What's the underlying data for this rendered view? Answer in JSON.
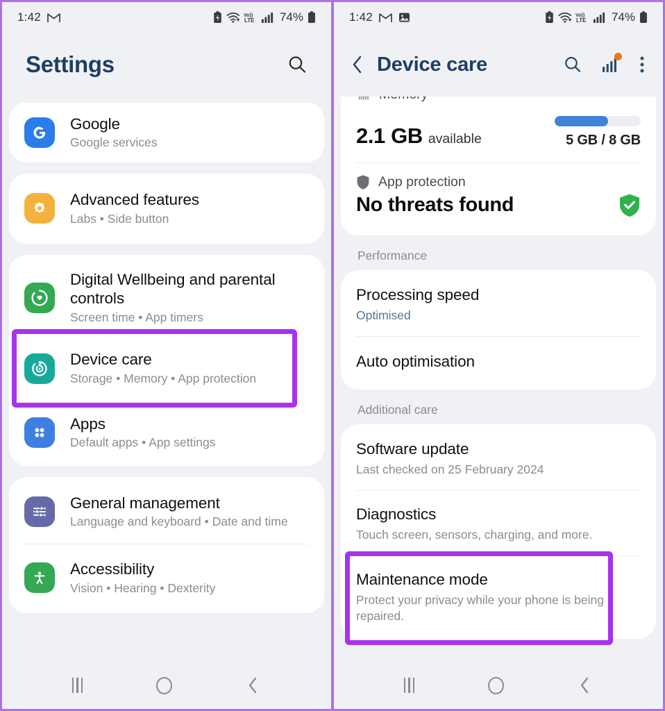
{
  "status_bar": {
    "time": "1:42",
    "battery_percent": "74%",
    "icons_left": [
      "gmail-icon",
      "gallery-icon"
    ],
    "icons_right": [
      "battery-saver-icon",
      "wifi-icon",
      "volte-icon",
      "signal-bars-icon",
      "battery-icon"
    ]
  },
  "left_phone": {
    "header": {
      "title": "Settings",
      "search_icon": "search-icon"
    },
    "groups": [
      {
        "items": [
          {
            "title": "Google",
            "subtitle": "Google services",
            "icon": "google-icon"
          }
        ]
      },
      {
        "items": [
          {
            "title": "Advanced features",
            "subtitle": "Labs  •  Side button",
            "icon": "gear-icon"
          }
        ]
      },
      {
        "items": [
          {
            "title": "Digital Wellbeing and parental controls",
            "subtitle": "Screen time  •  App timers",
            "icon": "wellbeing-icon"
          },
          {
            "title": "Device care",
            "subtitle": "Storage  •  Memory  •  App protection",
            "icon": "device-care-icon",
            "highlighted": true
          },
          {
            "title": "Apps",
            "subtitle": "Default apps  •  App settings",
            "icon": "apps-grid-icon"
          }
        ]
      },
      {
        "items": [
          {
            "title": "General management",
            "subtitle": "Language and keyboard  •  Date and time",
            "icon": "sliders-icon"
          },
          {
            "title": "Accessibility",
            "subtitle": "Vision  •  Hearing  •  Dexterity",
            "icon": "accessibility-icon"
          }
        ]
      }
    ]
  },
  "right_phone": {
    "header": {
      "title": "Device care",
      "back_icon": "chevron-left-icon",
      "search_icon": "search-icon",
      "stats_icon": "bar-chart-icon",
      "overflow_icon": "more-vertical-icon",
      "badge_color": "#f0761e"
    },
    "memory": {
      "label": "Memory",
      "icon": "memory-chip-icon",
      "value": "2.1 GB",
      "unit": "available",
      "usage_text": "5 GB / 8 GB",
      "progress_percent": 62,
      "progress_color": "#3f83d4"
    },
    "app_protection": {
      "label": "App protection",
      "icon": "shield-icon",
      "status": "No threats found",
      "status_icon": "shield-check-icon",
      "status_color": "#2fb14c"
    },
    "sections": [
      {
        "label": "Performance",
        "items": [
          {
            "title": "Processing speed",
            "subtitle": "Optimised",
            "subtitle_style": "blue"
          },
          {
            "title": "Auto optimisation",
            "subtitle": ""
          }
        ]
      },
      {
        "label": "Additional care",
        "items": [
          {
            "title": "Software update",
            "subtitle": "Last checked on 25 February 2024"
          },
          {
            "title": "Diagnostics",
            "subtitle": "Touch screen, sensors, charging, and more."
          },
          {
            "title": "Maintenance mode",
            "subtitle": "Protect your privacy while your phone is being repaired.",
            "highlighted": true
          }
        ]
      }
    ]
  },
  "nav_bar": {
    "recents_label": "recents-button",
    "home_label": "home-button",
    "back_label": "back-button"
  },
  "colors": {
    "frame_border": "#b06ee8",
    "highlight": "#a733ee",
    "title_blue": "#1d3f63",
    "panel_bg": "#f0f1f5"
  }
}
